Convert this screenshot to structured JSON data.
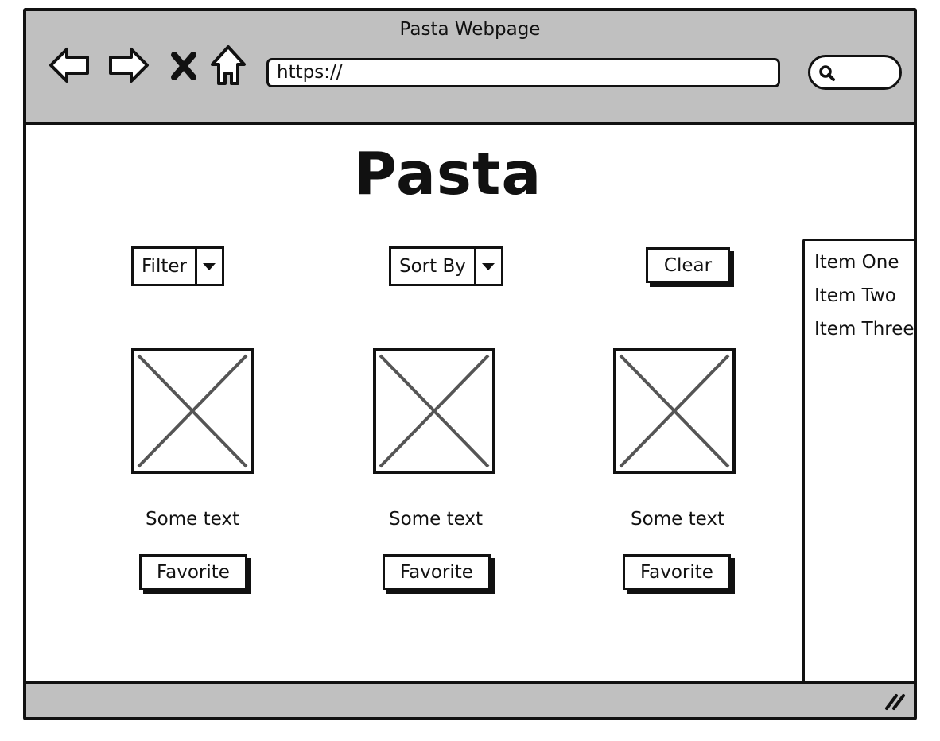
{
  "window": {
    "title": "Pasta Webpage",
    "url": "https://",
    "icons": [
      "back-arrow-icon",
      "forward-arrow-icon",
      "close-icon",
      "home-icon",
      "search-icon",
      "resize-grip-icon"
    ]
  },
  "page": {
    "heading": "Pasta"
  },
  "controls": {
    "filter_label": "Filter",
    "sort_label": "Sort By",
    "clear_label": "Clear"
  },
  "cards": [
    {
      "text": "Some text",
      "favorite_label": "Favorite"
    },
    {
      "text": "Some text",
      "favorite_label": "Favorite"
    },
    {
      "text": "Some text",
      "favorite_label": "Favorite"
    }
  ],
  "side_list": {
    "items": [
      "Item One",
      "Item Two",
      "Item Three"
    ]
  },
  "colors": {
    "chrome": "#c0c0c0",
    "ink": "#111111",
    "placeholder_x": "#555555"
  }
}
